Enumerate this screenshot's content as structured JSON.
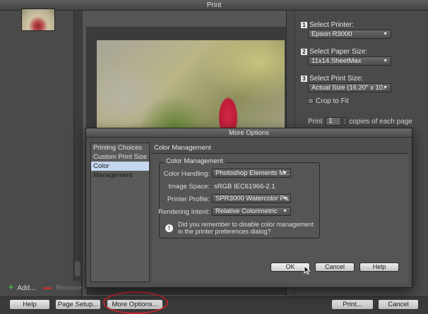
{
  "window": {
    "title": "Print"
  },
  "left_panel": {
    "add_label": "Add...",
    "remove_label": "Remove"
  },
  "settings": {
    "step1": {
      "num": "1",
      "label": "Select Printer:",
      "value": "Epson R3000"
    },
    "step2": {
      "num": "2",
      "label": "Select Paper Size:",
      "value": "11x14.SheetMax"
    },
    "step3": {
      "num": "3",
      "label": "Select Print Size:",
      "value": "Actual Size (16.20\" x 10."
    },
    "crop_label": "Crop to Fit",
    "print_label": "Print",
    "copies_value": "1",
    "copies_suffix": "copies of each page"
  },
  "bottom": {
    "help_label": "Help",
    "page_setup_label": "Page Setup...",
    "more_options_label": "More Options...",
    "print_label": "Print...",
    "cancel_label": "Cancel"
  },
  "dialog": {
    "title": "More Options",
    "list_items": [
      "Printing Choices",
      "Custom Print Size",
      "Color Management"
    ],
    "selected_index": 2,
    "section_title": "Color Management",
    "group_legend": "Color Management",
    "color_handling_label": "Color Handling:",
    "color_handling_value": "Photoshop Elements M...",
    "image_space_label": "Image Space:",
    "image_space_value": "sRGB IEC61966-2.1",
    "printer_profile_label": "Printer Profile:",
    "printer_profile_value": "SPR3000 Watercolor Pa...",
    "rendering_intent_label": "Rendering Intent:",
    "rendering_intent_value": "Relative Colorimetric",
    "info_text": "Did you remember to disable color management in the printer preferences dialog?",
    "ok_label": "OK",
    "cancel_label": "Cancel",
    "help_label": "Help"
  },
  "colors": {
    "highlight_ring": "#c0262d",
    "selected_item_bg": "#c6d7f0",
    "add_icon": "#3fbf3f",
    "remove_icon": "#b33333"
  }
}
